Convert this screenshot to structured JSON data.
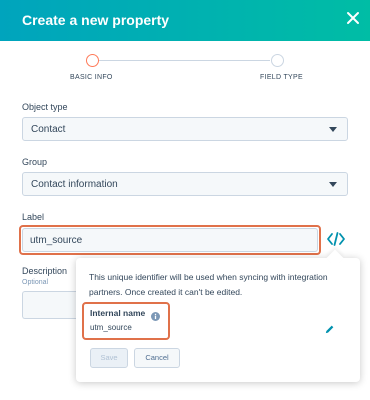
{
  "header": {
    "title": "Create a new property"
  },
  "steps": [
    {
      "label": "BASIC INFO",
      "state": "active"
    },
    {
      "label": "FIELD TYPE",
      "state": "inactive"
    }
  ],
  "object_type": {
    "label": "Object type",
    "value": "Contact"
  },
  "group": {
    "label": "Group",
    "value": "Contact information"
  },
  "label_field": {
    "label": "Label",
    "value": "utm_source"
  },
  "description": {
    "label": "Description",
    "optional": "Optional"
  },
  "popover": {
    "text": "This unique identifier will be used when syncing with integration partners. Once created it can't be edited.",
    "internal_name_label": "Internal name",
    "internal_name_value": "utm_source",
    "save_label": "Save",
    "cancel_label": "Cancel"
  },
  "colors": {
    "header_start": "#00a4bd",
    "header_end": "#00bda5",
    "highlight": "#e0714a",
    "accent": "#0091ae"
  },
  "icons": [
    "close-icon",
    "code-icon",
    "info-icon",
    "pencil-icon",
    "caret-down-icon"
  ]
}
